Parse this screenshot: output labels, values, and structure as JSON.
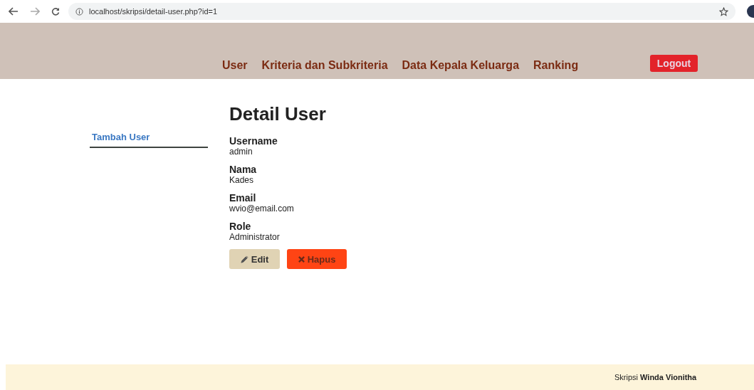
{
  "browser": {
    "url": "localhost/skripsi/detail-user.php?id=1"
  },
  "nav": {
    "items": [
      {
        "label": "User"
      },
      {
        "label": "Kriteria dan Subkriteria"
      },
      {
        "label": "Data Kepala Keluarga"
      },
      {
        "label": "Ranking"
      }
    ],
    "logout": "Logout"
  },
  "sidebar": {
    "items": [
      {
        "label": "Tambah User"
      }
    ]
  },
  "detail": {
    "title": "Detail User",
    "fields": [
      {
        "label": "Username",
        "value": "admin"
      },
      {
        "label": "Nama",
        "value": "Kades"
      },
      {
        "label": "Email",
        "value": "wvio@email.com"
      },
      {
        "label": "Role",
        "value": "Administrator"
      }
    ],
    "buttons": [
      {
        "kind": "edit",
        "label": "Edit"
      },
      {
        "kind": "delete",
        "label": "Hapus"
      }
    ]
  },
  "footer": {
    "text": "Skripsi **Winda Vionitha**"
  }
}
